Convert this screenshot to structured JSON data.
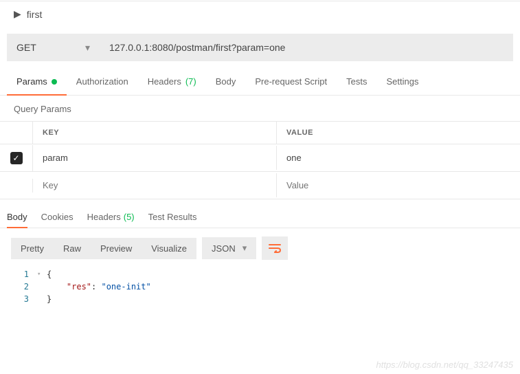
{
  "request": {
    "name": "first",
    "method": "GET",
    "url": "127.0.0.1:8080/postman/first?param=one"
  },
  "request_tabs": [
    {
      "label": "Params",
      "active": true,
      "indicator": "dot"
    },
    {
      "label": "Authorization"
    },
    {
      "label": "Headers",
      "badge": "(7)"
    },
    {
      "label": "Body"
    },
    {
      "label": "Pre-request Script"
    },
    {
      "label": "Tests"
    },
    {
      "label": "Settings"
    }
  ],
  "query_params": {
    "section_label": "Query Params",
    "headers": {
      "key": "KEY",
      "value": "VALUE"
    },
    "rows": [
      {
        "checked": true,
        "key": "param",
        "value": "one"
      }
    ],
    "placeholder": {
      "key": "Key",
      "value": "Value"
    }
  },
  "response_tabs": [
    {
      "label": "Body",
      "active": true
    },
    {
      "label": "Cookies"
    },
    {
      "label": "Headers",
      "badge": "(5)"
    },
    {
      "label": "Test Results"
    }
  ],
  "body_toolbar": {
    "views": [
      "Pretty",
      "Raw",
      "Preview",
      "Visualize"
    ],
    "format": "JSON"
  },
  "response_body": {
    "lines": [
      "{",
      "    \"res\": \"one-init\"",
      "}"
    ],
    "res_key": "\"res\"",
    "res_value": "\"one-init\""
  },
  "watermark": "https://blog.csdn.net/qq_33247435"
}
